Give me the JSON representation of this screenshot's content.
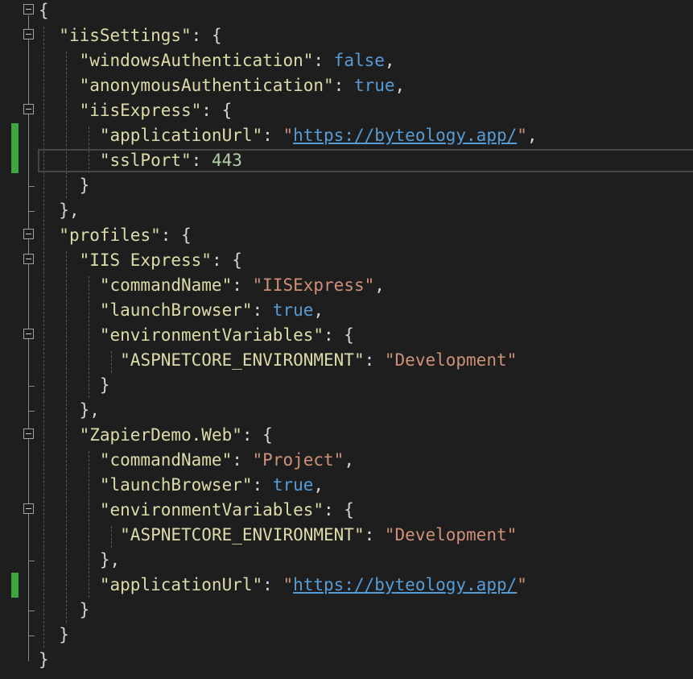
{
  "editor": {
    "lines": [
      [
        {
          "t": "{",
          "c": "p"
        }
      ],
      [
        {
          "t": "  ",
          "c": "p"
        },
        {
          "t": "\"iisSettings\"",
          "c": "k"
        },
        {
          "t": ": {",
          "c": "p"
        }
      ],
      [
        {
          "t": "    ",
          "c": "p"
        },
        {
          "t": "\"windowsAuthentication\"",
          "c": "k"
        },
        {
          "t": ": ",
          "c": "p"
        },
        {
          "t": "false",
          "c": "b"
        },
        {
          "t": ",",
          "c": "p"
        }
      ],
      [
        {
          "t": "    ",
          "c": "p"
        },
        {
          "t": "\"anonymousAuthentication\"",
          "c": "k"
        },
        {
          "t": ": ",
          "c": "p"
        },
        {
          "t": "true",
          "c": "b"
        },
        {
          "t": ",",
          "c": "p"
        }
      ],
      [
        {
          "t": "    ",
          "c": "p"
        },
        {
          "t": "\"iisExpress\"",
          "c": "k"
        },
        {
          "t": ": {",
          "c": "p"
        }
      ],
      [
        {
          "t": "      ",
          "c": "p"
        },
        {
          "t": "\"applicationUrl\"",
          "c": "k"
        },
        {
          "t": ": ",
          "c": "p"
        },
        {
          "t": "\"",
          "c": "s"
        },
        {
          "t": "https://byteology.app/",
          "c": "u"
        },
        {
          "t": "\"",
          "c": "s"
        },
        {
          "t": ",",
          "c": "p"
        }
      ],
      [
        {
          "t": "      ",
          "c": "p"
        },
        {
          "t": "\"sslPort\"",
          "c": "k"
        },
        {
          "t": ": ",
          "c": "p"
        },
        {
          "t": "443",
          "c": "n"
        }
      ],
      [
        {
          "t": "    }",
          "c": "p"
        }
      ],
      [
        {
          "t": "  },",
          "c": "p"
        }
      ],
      [
        {
          "t": "  ",
          "c": "p"
        },
        {
          "t": "\"profiles\"",
          "c": "k"
        },
        {
          "t": ": {",
          "c": "p"
        }
      ],
      [
        {
          "t": "    ",
          "c": "p"
        },
        {
          "t": "\"IIS Express\"",
          "c": "k"
        },
        {
          "t": ": {",
          "c": "p"
        }
      ],
      [
        {
          "t": "      ",
          "c": "p"
        },
        {
          "t": "\"commandName\"",
          "c": "k"
        },
        {
          "t": ": ",
          "c": "p"
        },
        {
          "t": "\"IISExpress\"",
          "c": "s"
        },
        {
          "t": ",",
          "c": "p"
        }
      ],
      [
        {
          "t": "      ",
          "c": "p"
        },
        {
          "t": "\"launchBrowser\"",
          "c": "k"
        },
        {
          "t": ": ",
          "c": "p"
        },
        {
          "t": "true",
          "c": "b"
        },
        {
          "t": ",",
          "c": "p"
        }
      ],
      [
        {
          "t": "      ",
          "c": "p"
        },
        {
          "t": "\"environmentVariables\"",
          "c": "k"
        },
        {
          "t": ": {",
          "c": "p"
        }
      ],
      [
        {
          "t": "        ",
          "c": "p"
        },
        {
          "t": "\"ASPNETCORE_ENVIRONMENT\"",
          "c": "k"
        },
        {
          "t": ": ",
          "c": "p"
        },
        {
          "t": "\"Development\"",
          "c": "s"
        }
      ],
      [
        {
          "t": "      }",
          "c": "p"
        }
      ],
      [
        {
          "t": "    },",
          "c": "p"
        }
      ],
      [
        {
          "t": "    ",
          "c": "p"
        },
        {
          "t": "\"ZapierDemo.Web\"",
          "c": "k"
        },
        {
          "t": ": {",
          "c": "p"
        }
      ],
      [
        {
          "t": "      ",
          "c": "p"
        },
        {
          "t": "\"commandName\"",
          "c": "k"
        },
        {
          "t": ": ",
          "c": "p"
        },
        {
          "t": "\"Project\"",
          "c": "s"
        },
        {
          "t": ",",
          "c": "p"
        }
      ],
      [
        {
          "t": "      ",
          "c": "p"
        },
        {
          "t": "\"launchBrowser\"",
          "c": "k"
        },
        {
          "t": ": ",
          "c": "p"
        },
        {
          "t": "true",
          "c": "b"
        },
        {
          "t": ",",
          "c": "p"
        }
      ],
      [
        {
          "t": "      ",
          "c": "p"
        },
        {
          "t": "\"environmentVariables\"",
          "c": "k"
        },
        {
          "t": ": {",
          "c": "p"
        }
      ],
      [
        {
          "t": "        ",
          "c": "p"
        },
        {
          "t": "\"ASPNETCORE_ENVIRONMENT\"",
          "c": "k"
        },
        {
          "t": ": ",
          "c": "p"
        },
        {
          "t": "\"Development\"",
          "c": "s"
        }
      ],
      [
        {
          "t": "      },",
          "c": "p"
        }
      ],
      [
        {
          "t": "      ",
          "c": "p"
        },
        {
          "t": "\"applicationUrl\"",
          "c": "k"
        },
        {
          "t": ": ",
          "c": "p"
        },
        {
          "t": "\"",
          "c": "s"
        },
        {
          "t": "https://byteology.app/",
          "c": "u"
        },
        {
          "t": "\"",
          "c": "s"
        }
      ],
      [
        {
          "t": "    }",
          "c": "p"
        }
      ],
      [
        {
          "t": "  }",
          "c": "p"
        }
      ],
      [
        {
          "t": "}",
          "c": "p"
        }
      ]
    ],
    "fold_lines": [
      0,
      1,
      4,
      9,
      10,
      13,
      17,
      20
    ],
    "changed_lines": [
      5,
      6,
      23
    ],
    "current_line": 6,
    "colors": {
      "key": "#dcdcaa",
      "string": "#ce9178",
      "boolean": "#569cd6",
      "number": "#b5cea8",
      "link": "#569cd6",
      "change_marker": "#3fa63f"
    }
  }
}
